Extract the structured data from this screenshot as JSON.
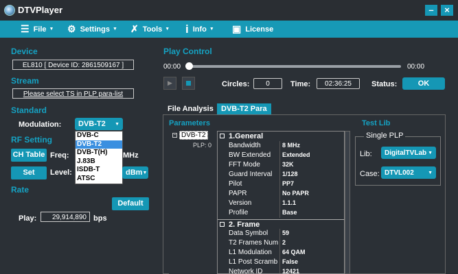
{
  "app": {
    "title": "DTVPlayer",
    "minimize": "–",
    "close": "×"
  },
  "menu": [
    {
      "label": "File",
      "icon": "list-icon"
    },
    {
      "label": "Settings",
      "icon": "gear-icon"
    },
    {
      "label": "Tools",
      "icon": "wrench-icon"
    },
    {
      "label": "Info",
      "icon": "info-icon"
    },
    {
      "label": "License",
      "icon": "license-icon"
    }
  ],
  "device": {
    "section": "Device",
    "value": "EL810 [ Device ID: 2861509167 ]"
  },
  "stream": {
    "section": "Stream",
    "value": "Please select TS in PLP para-list"
  },
  "standard": {
    "section": "Standard",
    "modulation_label": "Modulation:",
    "modulation_value": "DVB-T2",
    "options": [
      "DVB-C",
      "DVB-T2",
      "DVB-T(H)",
      "J.83B",
      "ISDB-T",
      "ATSC"
    ],
    "selected_index": 1
  },
  "rf": {
    "section": "RF Setting",
    "ch_table": "CH Table",
    "freq_label": "Freq:",
    "freq_unit": "MHz",
    "set": "Set",
    "level_label": "Level:",
    "level_unit": "dBm"
  },
  "rate": {
    "section": "Rate",
    "default": "Default",
    "play_label": "Play:",
    "play_value": "29,914,890",
    "unit": "bps"
  },
  "play": {
    "section": "Play Control",
    "start_time": "00:00",
    "end_time": "00:00",
    "progress": 0,
    "circles_label": "Circles:",
    "circles_value": "0",
    "time_label": "Time:",
    "time_value": "02:36:25",
    "status_label": "Status:",
    "status_value": "OK"
  },
  "tabs": [
    {
      "label": "File Analysis"
    },
    {
      "label": "DVB-T2 Para"
    }
  ],
  "params": {
    "header": "Parameters",
    "tree_root": "DVB-T2",
    "tree_child": "PLP: 0",
    "groups": [
      {
        "title": "1.General",
        "rows": [
          [
            "Bandwidth",
            "8 MHz"
          ],
          [
            "BW Extended",
            "Extended"
          ],
          [
            "FFT Mode",
            "32K"
          ],
          [
            "Guard Interval",
            "1/128"
          ],
          [
            "Pilot",
            "PP7"
          ],
          [
            "PAPR",
            "No PAPR"
          ],
          [
            "Version",
            "1.1.1"
          ],
          [
            "Profile",
            "Base"
          ]
        ]
      },
      {
        "title": "2. Frame",
        "rows": [
          [
            "Data Symbol",
            "59"
          ],
          [
            "T2 Frames Num",
            "2"
          ],
          [
            "L1 Modulation",
            "64 QAM"
          ],
          [
            "L1 Post Scramb",
            "False"
          ],
          [
            "Network ID",
            "12421"
          ]
        ]
      }
    ]
  },
  "testlib": {
    "header": "Test Lib",
    "group": "Single PLP",
    "lib_label": "Lib:",
    "lib_value": "DigitalTVLab",
    "case_label": "Case:",
    "case_value": "DTVL002"
  },
  "colors": {
    "accent": "#1597b5",
    "background": "#2b3036",
    "section": "#15a3c4"
  }
}
